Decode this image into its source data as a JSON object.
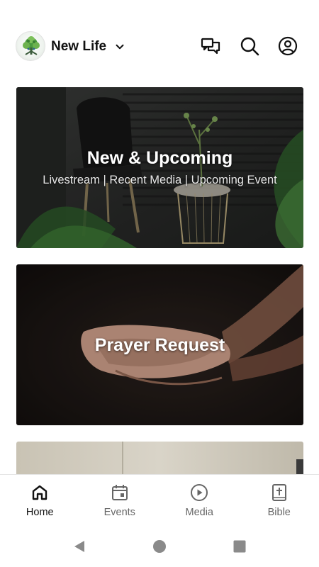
{
  "header": {
    "title": "New Life",
    "icons": {
      "logo": "tree-logo-icon",
      "dropdown": "chevron-down-icon",
      "messages": "messages-icon",
      "search": "search-icon",
      "account": "account-icon"
    }
  },
  "cards": [
    {
      "title": "New & Upcoming",
      "subtitle": "Livestream | Recent Media | Upcoming Event"
    },
    {
      "title": "Prayer Request"
    },
    {
      "title": ""
    }
  ],
  "bottom_nav": {
    "active": "Home",
    "items": [
      {
        "label": "Home",
        "icon": "home-icon"
      },
      {
        "label": "Events",
        "icon": "calendar-icon"
      },
      {
        "label": "Media",
        "icon": "play-circle-icon"
      },
      {
        "label": "Bible",
        "icon": "bible-icon"
      }
    ]
  },
  "system_nav": {
    "icons": [
      "back-icon",
      "home-circle-icon",
      "recents-icon"
    ]
  },
  "colors": {
    "text_primary": "#111111",
    "text_secondary": "#666666",
    "logo_green": "#3f8f3a",
    "system_gray": "#8a8a8a"
  }
}
